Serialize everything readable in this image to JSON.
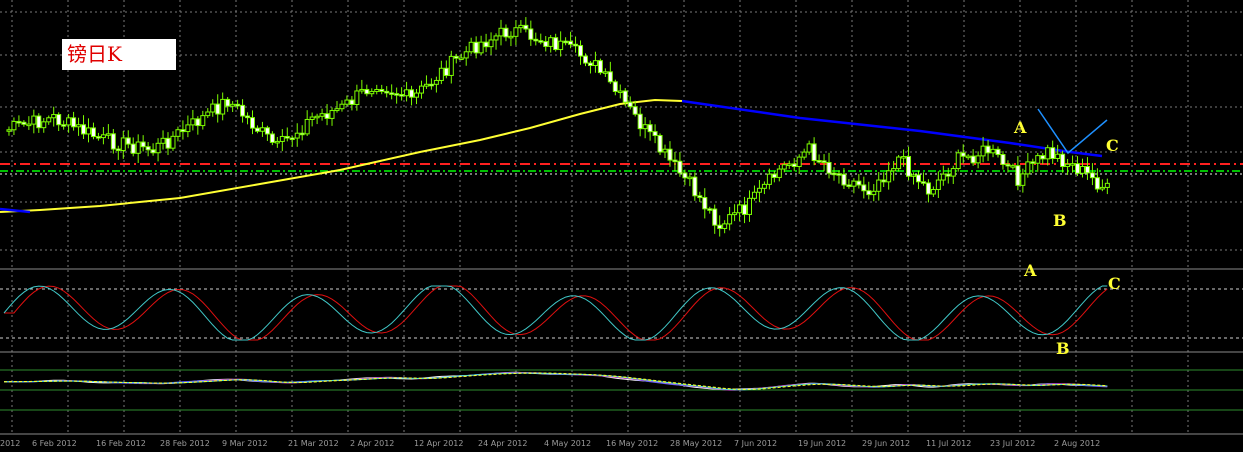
{
  "title": "镑日K",
  "colors": {
    "background": "#000000",
    "candle_up": "#000000",
    "candle_down": "#ffffff",
    "candle_border": "#7cfc00",
    "moving_average": "#ffff33",
    "trendline": "#0000ff",
    "pattern_line": "#1e90ff",
    "resistance_red": "#ff2020",
    "support_green": "#00c000",
    "grid": "#7a7a7a",
    "osc_fast": "#40c8c8",
    "osc_slow": "#e01010",
    "label": "#ffff33"
  },
  "annotations": {
    "main_A": "A",
    "main_B": "B",
    "main_C": "C",
    "osc_A": "A",
    "osc_B": "B",
    "osc_C": "C"
  },
  "indicator_caption": "",
  "chart_data": {
    "type": "candlestick",
    "timeframe": "daily",
    "x_tick_labels": [
      "2012",
      "6 Feb 2012",
      "16 Feb 2012",
      "28 Feb 2012",
      "9 Mar 2012",
      "21 Mar 2012",
      "2 Apr 2012",
      "12 Apr 2012",
      "24 Apr 2012",
      "4 May 2012",
      "16 May 2012",
      "28 May 2012",
      "7 Jun 2012",
      "19 Jun 2012",
      "29 Jun 2012",
      "11 Jul 2012",
      "23 Jul 2012",
      "2 Aug 2012"
    ],
    "anchors": [
      [
        0,
        130
      ],
      [
        10,
        118
      ],
      [
        20,
        140
      ],
      [
        30,
        150
      ],
      [
        40,
        118
      ],
      [
        45,
        100
      ],
      [
        55,
        148
      ],
      [
        62,
        118
      ],
      [
        68,
        108
      ],
      [
        75,
        82
      ],
      [
        82,
        100
      ],
      [
        88,
        72
      ],
      [
        95,
        45
      ],
      [
        102,
        30
      ],
      [
        110,
        42
      ],
      [
        118,
        60
      ],
      [
        124,
        98
      ],
      [
        132,
        150
      ],
      [
        138,
        185
      ],
      [
        144,
        225
      ],
      [
        150,
        205
      ],
      [
        156,
        170
      ],
      [
        162,
        150
      ],
      [
        168,
        175
      ],
      [
        174,
        190
      ],
      [
        180,
        158
      ],
      [
        186,
        190
      ],
      [
        192,
        160
      ],
      [
        198,
        150
      ],
      [
        204,
        178
      ],
      [
        210,
        152
      ],
      [
        216,
        168
      ],
      [
        222,
        190
      ]
    ],
    "series": [
      {
        "name": "",
        "kind": "moving-average"
      },
      {
        "name": "",
        "kind": "trendline"
      },
      {
        "name": "",
        "kind": "stochastic-main"
      },
      {
        "name": "",
        "kind": "stochastic-signal"
      },
      {
        "name": "",
        "kind": "rsi-multi"
      }
    ],
    "horizontal_levels": [
      "resistance",
      "support"
    ],
    "grid": true
  }
}
